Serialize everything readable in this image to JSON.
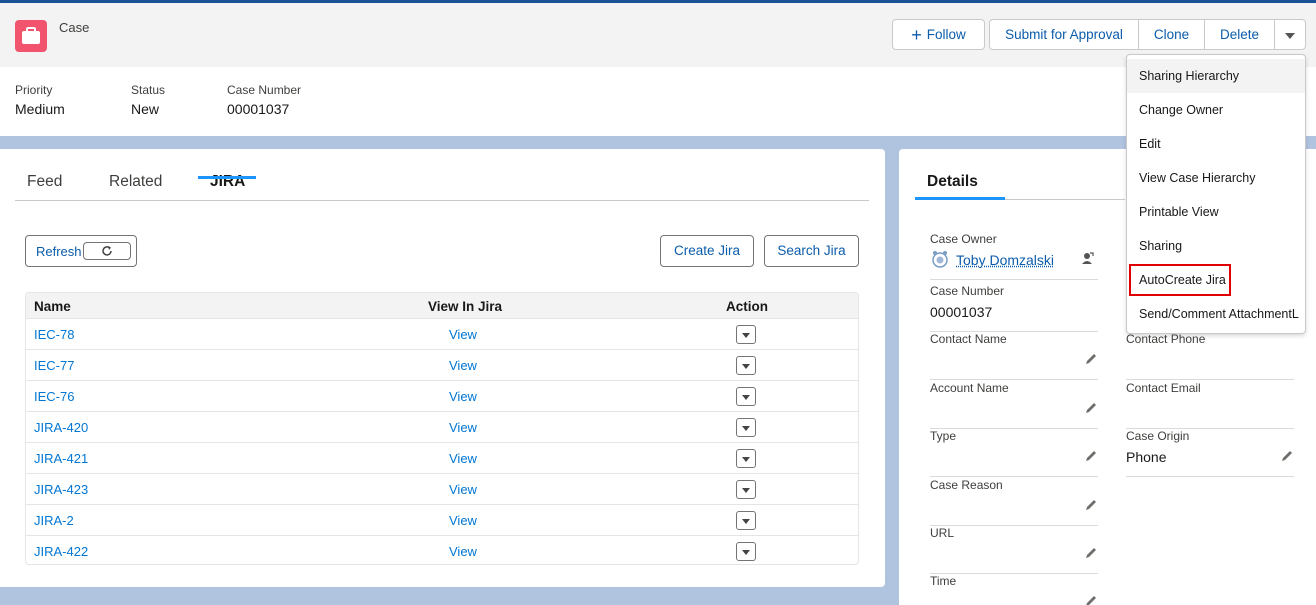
{
  "header": {
    "object_label": "Case",
    "buttons": {
      "follow": "Follow",
      "submit": "Submit for Approval",
      "clone": "Clone",
      "delete": "Delete"
    },
    "highlights": [
      {
        "label": "Priority",
        "value": "Medium"
      },
      {
        "label": "Status",
        "value": "New"
      },
      {
        "label": "Case Number",
        "value": "00001037"
      }
    ]
  },
  "tabs": {
    "feed": "Feed",
    "related": "Related",
    "jira": "JIRA",
    "active": "JIRA"
  },
  "jira_panel": {
    "refresh_label": "Refresh",
    "create_label": "Create Jira",
    "search_label": "Search Jira",
    "columns": {
      "name": "Name",
      "view": "View In Jira",
      "action": "Action"
    },
    "rows": [
      {
        "name": "IEC-78",
        "view": "View"
      },
      {
        "name": "IEC-77",
        "view": "View"
      },
      {
        "name": "IEC-76",
        "view": "View"
      },
      {
        "name": "JIRA-420",
        "view": "View"
      },
      {
        "name": "JIRA-421",
        "view": "View"
      },
      {
        "name": "JIRA-423",
        "view": "View"
      },
      {
        "name": "JIRA-2",
        "view": "View"
      },
      {
        "name": "JIRA-422",
        "view": "View"
      }
    ]
  },
  "details": {
    "tab": "Details",
    "fields": {
      "case_owner": {
        "label": "Case Owner",
        "value": "Toby Domzalski"
      },
      "case_number": {
        "label": "Case Number",
        "value": "00001037"
      },
      "contact_name": {
        "label": "Contact Name",
        "value": ""
      },
      "contact_phone": {
        "label": "Contact Phone",
        "value": ""
      },
      "account_name": {
        "label": "Account Name",
        "value": ""
      },
      "contact_email": {
        "label": "Contact Email",
        "value": ""
      },
      "type": {
        "label": "Type",
        "value": ""
      },
      "case_origin": {
        "label": "Case Origin",
        "value": "Phone"
      },
      "case_reason": {
        "label": "Case Reason",
        "value": ""
      },
      "url": {
        "label": "URL",
        "value": ""
      },
      "time": {
        "label": "Time",
        "value": ""
      }
    }
  },
  "dropdown": {
    "items": [
      "Sharing Hierarchy",
      "Change Owner",
      "Edit",
      "View Case Hierarchy",
      "Printable View",
      "Sharing",
      "AutoCreate Jira",
      "Send/Comment AttachmentL"
    ],
    "hovered": "Sharing Hierarchy",
    "highlighted": "AutoCreate Jira"
  },
  "colors": {
    "brand_blue": "#0b5cab",
    "link_blue": "#0176d3",
    "case_icon": "#f2536d",
    "highlight_red": "#e00000",
    "page_bg": "#b0c4df"
  },
  "icons": {
    "case": "briefcase-icon",
    "follow": "plus-icon",
    "more": "chevron-down-icon",
    "refresh": "refresh-icon",
    "row_action": "chevron-down-icon",
    "edit": "pencil-icon",
    "owner_avatar": "avatar-icon",
    "change_owner": "change-owner-icon"
  }
}
